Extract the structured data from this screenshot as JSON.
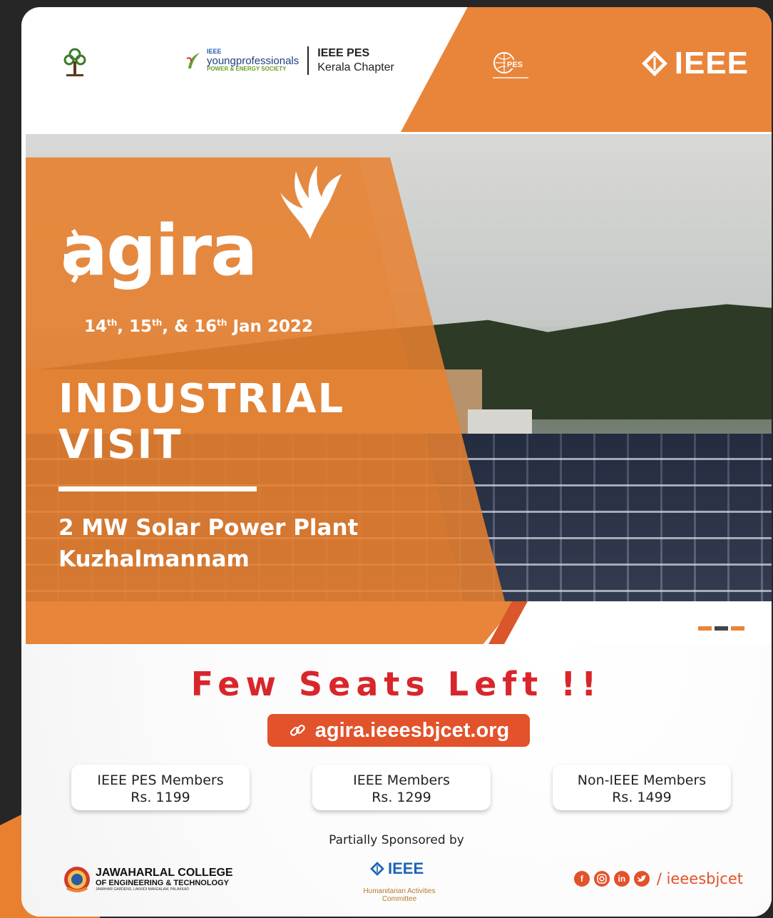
{
  "header": {
    "yp_small": "IEEE",
    "yp_main": "youngprofessionals",
    "yp_sub": "POWER & ENERGY SOCIETY",
    "pes_line1": "IEEE PES",
    "pes_line2": "Kerala Chapter",
    "ieee_logo": "IEEE"
  },
  "hero": {
    "brand": "agira",
    "date_d1": "14",
    "date_d2": "15",
    "date_d3": "16",
    "date_suffix": "th",
    "date_tail": "Jan 2022",
    "title_line1": "INDUSTRIAL",
    "title_line2": "VISIT",
    "plant_line1": "2 MW Solar Power Plant",
    "plant_line2": "Kuzhalmannam"
  },
  "cta": {
    "seats": "Few Seats Left !!",
    "url": "agira.ieeesbjcet.org",
    "url_icon": "link-icon"
  },
  "prices": [
    {
      "label": "IEEE PES Members",
      "amount": "Rs. 1199"
    },
    {
      "label": "IEEE Members",
      "amount": "Rs. 1299"
    },
    {
      "label": "Non-IEEE Members",
      "amount": "Rs. 1499"
    }
  ],
  "footer": {
    "sponsored": "Partially Sponsored by",
    "ieee_blue": "IEEE",
    "hac": "Humanitarian Activities Committee",
    "college_line1": "JAWAHARLAL COLLEGE",
    "college_line2": "OF ENGINEERING & TECHNOLOGY",
    "college_line3": "JAWAHAR GARDENS, LAKKIDI MANGALAM, PALAKKAD",
    "handle": "/ ieeesbjcet"
  },
  "colors": {
    "orange": "#e8853a",
    "red": "#d8262b",
    "url_bg": "#e2522b",
    "ieee_blue": "#1c64b3"
  }
}
